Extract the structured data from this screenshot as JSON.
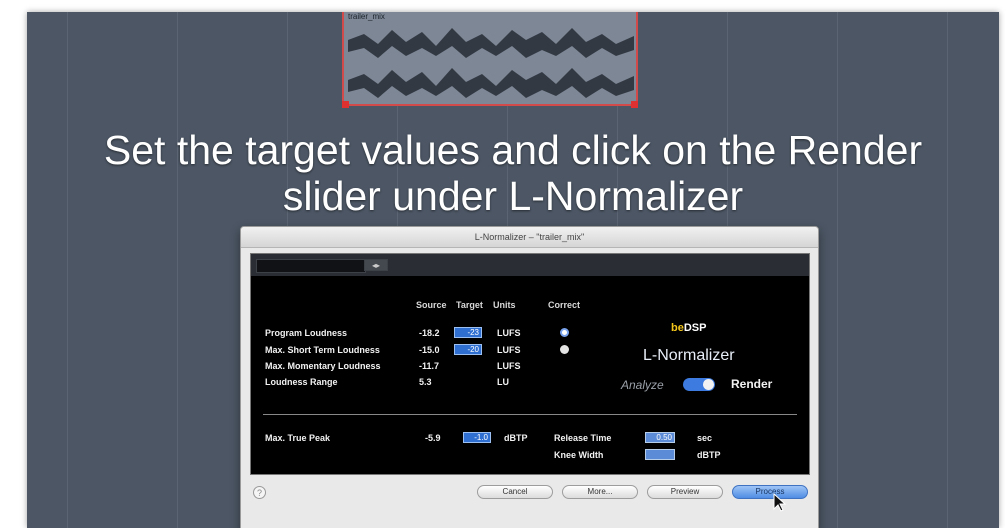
{
  "caption": {
    "line1": "Set the target values and click on the Render",
    "line2": "slider under L-Normalizer"
  },
  "clip": {
    "name": "trailer_mix"
  },
  "dialog": {
    "title": "L-Normalizer – \"trailer_mix\"",
    "preset_arrows": "◂▸",
    "headers": {
      "source": "Source",
      "target": "Target",
      "units": "Units",
      "correct": "Correct"
    },
    "rows": [
      {
        "label": "Program Loudness",
        "source": "-18.2",
        "target": "-23",
        "units": "LUFS",
        "correct": "selected"
      },
      {
        "label": "Max. Short Term Loudness",
        "source": "-15.0",
        "target": "-20",
        "units": "LUFS",
        "correct": "unselected"
      },
      {
        "label": "Max. Momentary Loudness",
        "source": "-11.7",
        "target": "",
        "units": "LUFS",
        "correct": "none"
      },
      {
        "label": "Loudness Range",
        "source": "5.3",
        "target": "",
        "units": "LU",
        "correct": "none"
      }
    ],
    "peak": {
      "label": "Max. True Peak",
      "source": "-5.9",
      "target": "-1.0",
      "units": "dBTP"
    },
    "release": {
      "label": "Release Time",
      "value": "0.50",
      "units": "sec"
    },
    "knee": {
      "label": "Knee Width",
      "value": "",
      "units": "dBTP"
    },
    "brand": {
      "vendor_a": "be",
      "vendor_b": "DSP",
      "product": "L-Normalizer"
    },
    "mode": {
      "analyze": "Analyze",
      "render": "Render",
      "render_on": true
    },
    "help": "?",
    "buttons": {
      "cancel": "Cancel",
      "more": "More...",
      "preview": "Preview",
      "process": "Process"
    }
  },
  "colors": {
    "background": "#4c5664",
    "accent_blue": "#3d7be0",
    "clip_selection": "#d24a4a",
    "brand_yellow": "#f3c51a"
  }
}
